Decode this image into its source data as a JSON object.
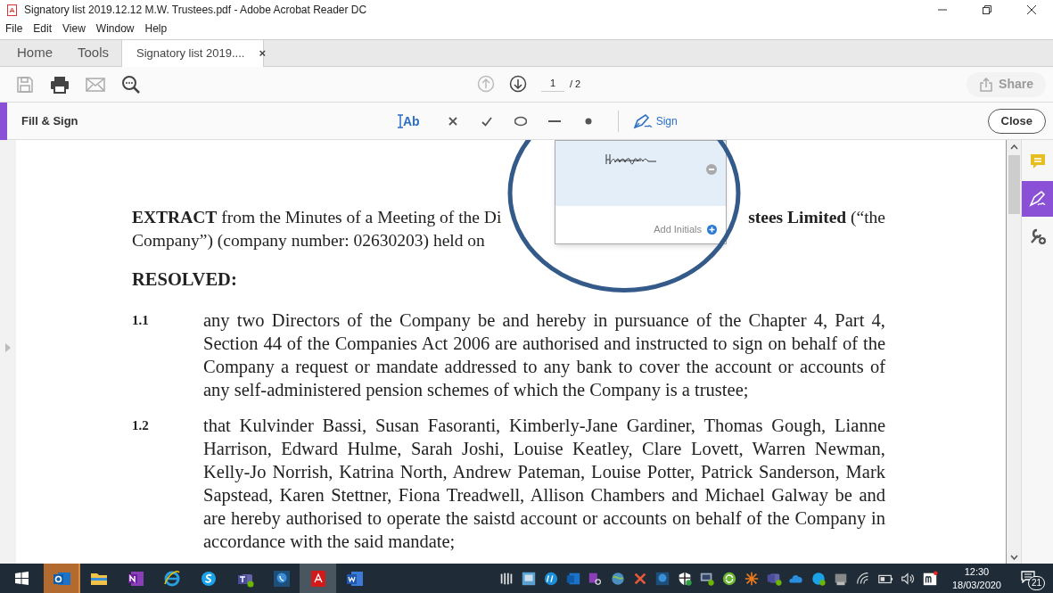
{
  "window": {
    "title": "Signatory list 2019.12.12 M.W. Trustees.pdf - Adobe Acrobat Reader DC"
  },
  "menu": [
    "File",
    "Edit",
    "View",
    "Window",
    "Help"
  ],
  "tabs": [
    {
      "label": "Home",
      "kind": "nav",
      "selected": false
    },
    {
      "label": "Tools",
      "kind": "nav",
      "selected": false
    },
    {
      "label": "Signatory list 2019....",
      "kind": "document",
      "selected": true,
      "close": "×"
    }
  ],
  "toolbar": {
    "page": "1",
    "page_total": "/ 2",
    "share": {
      "label": "Share",
      "disabled": true
    }
  },
  "fill_sign": {
    "title": "Fill & Sign",
    "close": "Close",
    "tools": [
      {
        "kind": "text",
        "label": "Ab"
      },
      {
        "kind": "cross"
      },
      {
        "kind": "check"
      },
      {
        "kind": "ellipse"
      },
      {
        "kind": "line"
      },
      {
        "kind": "dot"
      },
      {
        "kind": "sign",
        "label": "Sign"
      }
    ]
  },
  "signature_menu": {
    "action": "Add Initials"
  },
  "document": {
    "heading_left": "**EXTRACT** from the Minutes of a Meeting of the Di",
    "heading_right": "**stees Limited** (“the",
    "line2": "Company”) (company number: 02630203) held on",
    "resolved": "RESOLVED:",
    "clauses": [
      {
        "number": "1.1",
        "text": "any two Directors of the Company be and hereby in pursuance of the Chapter 4, Part 4, Section 44 of the Companies Act 2006 are authorised and instructed to sign on behalf of the Company a request or mandate addressed to any bank to cover the account or accounts of any self-administered pension schemes of which the Company is a trustee;"
      },
      {
        "number": "1.2",
        "text": "that Kulvinder Bassi, Susan Fasoranti, Kimberly-Jane Gardiner, Thomas Gough, Lianne Harrison, Edward Hulme, Sarah Joshi, Louise Keatley, Clare Lovett, Warren Newman, Kelly-Jo Norrish, Katrina North, Andrew Pateman, Louise Potter, Patrick Sanderson, Mark Sapstead, Karen Stettner, Fiona Treadwell, Allison Chambers and Michael Galway be and are hereby authorised to operate the saistd account or accounts on behalf of the Company in accordance with the said mandate;"
      }
    ]
  },
  "right_panel": [
    {
      "kind": "comment",
      "selected": false
    },
    {
      "kind": "fill_sign",
      "selected": true
    },
    {
      "kind": "more_tools",
      "selected": false
    }
  ],
  "taskbar": {
    "apps": [
      {
        "kind": "outlook",
        "highlighted": true,
        "selected": false
      },
      {
        "kind": "files",
        "highlighted": false,
        "selected": false
      },
      {
        "kind": "notes",
        "highlighted": false,
        "selected": false
      },
      {
        "kind": "browser",
        "highlighted": false,
        "selected": false
      },
      {
        "kind": "chat",
        "highlighted": false,
        "selected": false
      },
      {
        "kind": "teams",
        "highlighted": false,
        "selected": false
      },
      {
        "kind": "phone",
        "highlighted": false,
        "selected": false
      },
      {
        "kind": "pdf",
        "highlighted": false,
        "selected": true
      },
      {
        "kind": "word",
        "highlighted": false,
        "selected": false
      }
    ],
    "time": "12:30",
    "date": "18/03/2020",
    "notifications": "21"
  }
}
